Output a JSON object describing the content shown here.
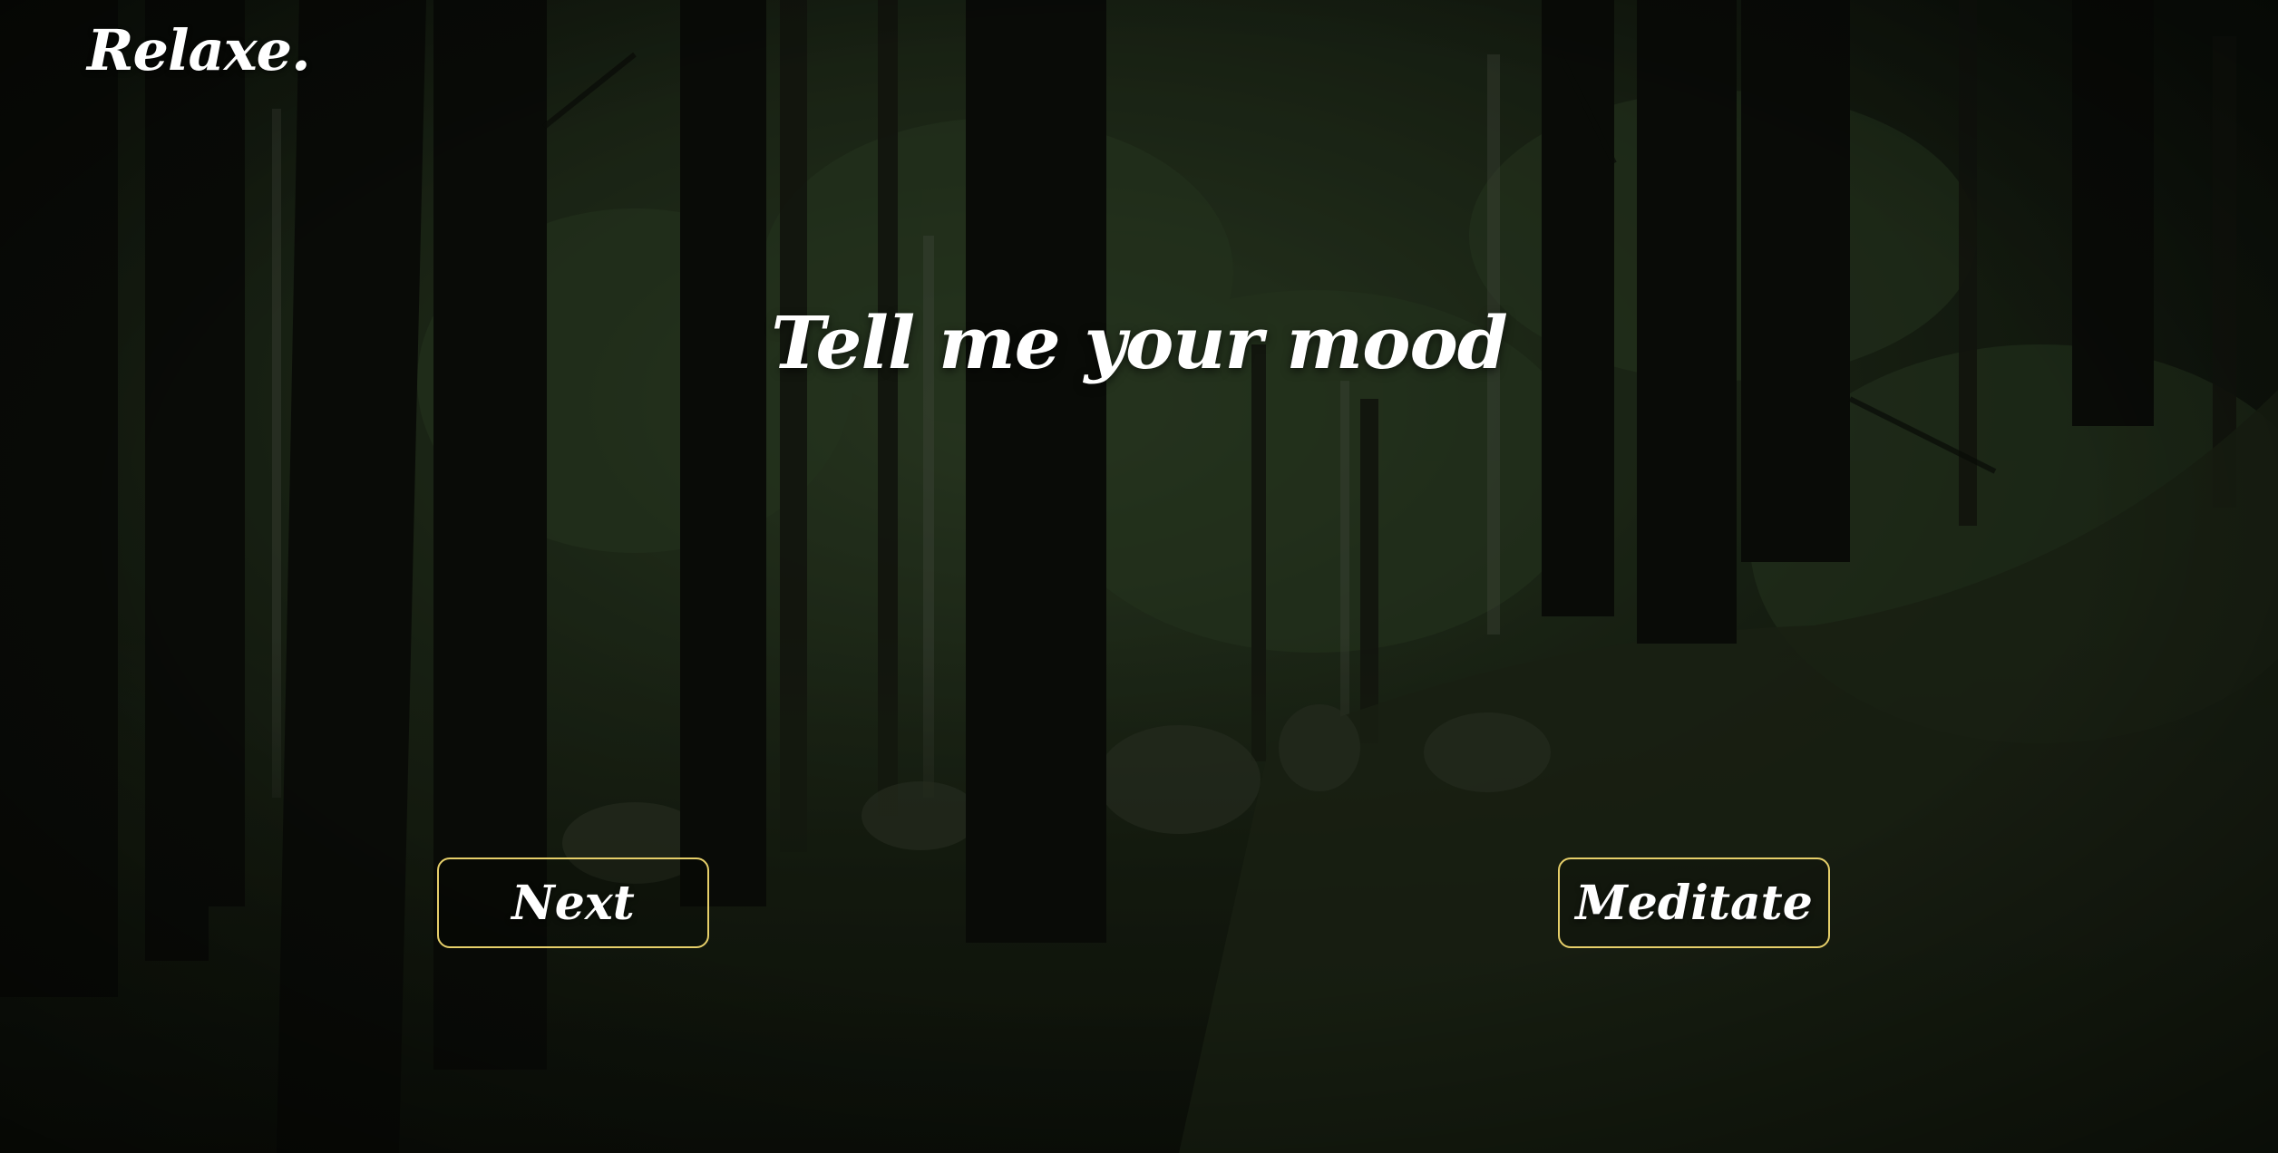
{
  "brand": {
    "logo_text": "Relaxe."
  },
  "main": {
    "heading": "Tell me your mood"
  },
  "actions": {
    "next_label": "Next",
    "meditate_label": "Meditate"
  },
  "colors": {
    "button_border": "#e6cf6a",
    "text": "#ffffff",
    "background_base": "#121a10"
  },
  "background": {
    "icon": "forest-background-image"
  }
}
